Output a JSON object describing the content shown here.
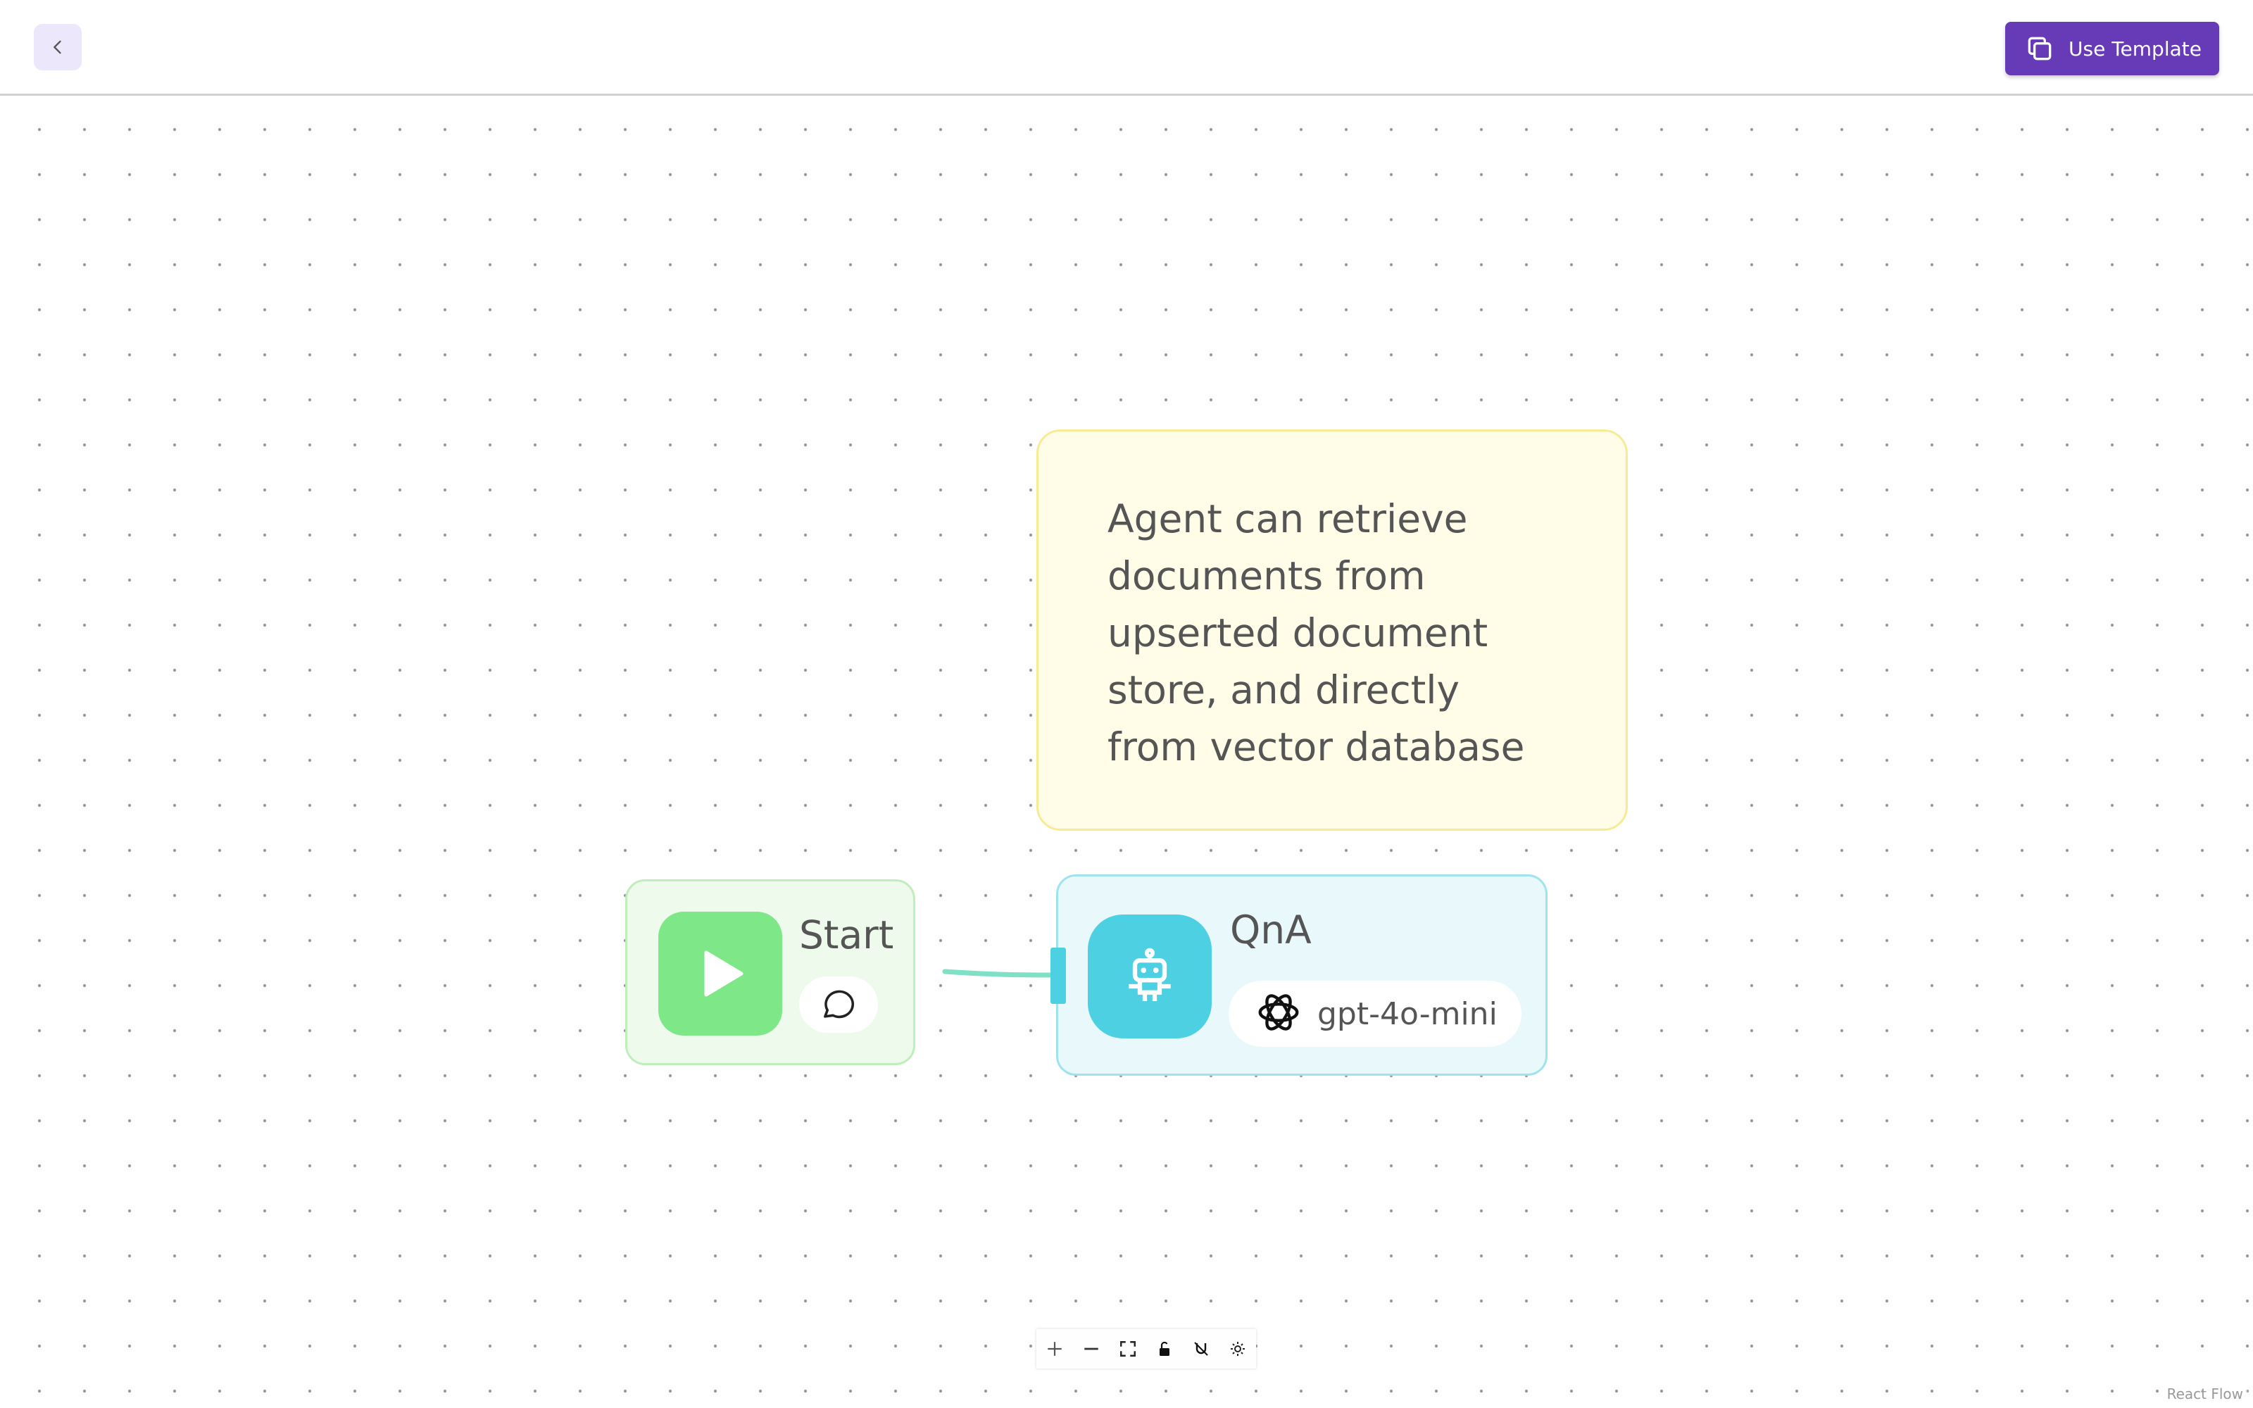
{
  "header": {
    "back_icon": "chevron-left-icon",
    "use_template_label": "Use Template",
    "use_template_icon": "copy-icon",
    "accent_color": "#673ab7"
  },
  "canvas": {
    "sticky_note": {
      "text": "Agent can retrieve documents from upserted document store, and directly from vector database",
      "color": "#fffde8"
    },
    "nodes": [
      {
        "id": "start",
        "label": "Start",
        "icon": "play-icon",
        "chip_icon": "chat-bubble-icon",
        "color": "#7ee787"
      },
      {
        "id": "qna",
        "label": "QnA",
        "icon": "robot-icon",
        "model_label": "gpt-4o-mini",
        "model_icon": "openai-logo-icon",
        "color": "#4dd0e1"
      }
    ],
    "edge": {
      "from": "start",
      "to": "qna"
    }
  },
  "controls": {
    "items": [
      "zoom-in-icon",
      "zoom-out-icon",
      "fit-view-icon",
      "lock-icon",
      "snap-icon",
      "settings-icon"
    ]
  },
  "attribution": "React Flow"
}
